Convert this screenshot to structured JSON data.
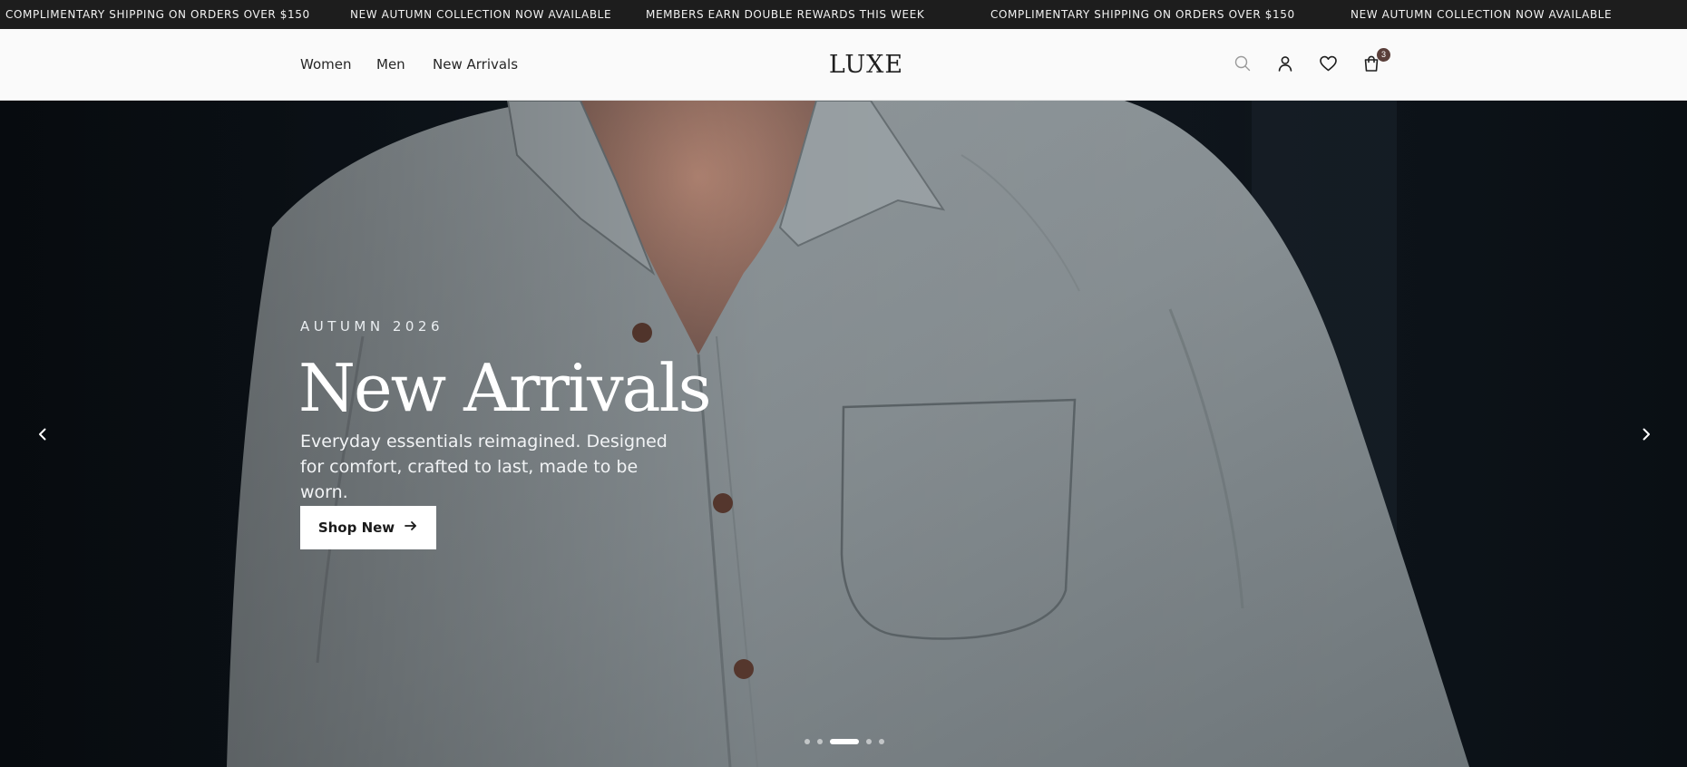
{
  "announcement": {
    "messages": [
      "COMPLIMENTARY SHIPPING ON ORDERS OVER $150",
      "NEW AUTUMN COLLECTION NOW AVAILABLE",
      "MEMBERS EARN DOUBLE REWARDS THIS WEEK",
      "COMPLIMENTARY SHIPPING ON ORDERS OVER $150",
      "NEW AUTUMN COLLECTION NOW AVAILABLE"
    ]
  },
  "header": {
    "nav": [
      "Women",
      "Men",
      "New Arrivals"
    ],
    "logo": "LUXE",
    "cart_count": "3",
    "icons": [
      "search-icon",
      "account-icon",
      "wishlist-icon",
      "cart-icon"
    ]
  },
  "hero": {
    "eyebrow": "AUTUMN 2026",
    "title": "New Arrivals",
    "subtitle": "Everyday essentials reimagined. Designed for comfort, crafted to last, made to be worn.",
    "cta": "Shop New",
    "slide_count": 5,
    "active_slide": 3
  },
  "colors": {
    "announcement_bg": "#1d1d1d",
    "header_bg": "#fafafa",
    "badge_bg": "#5a3f3a",
    "hero_bg": "#0b1016",
    "shirt": "#8b9397"
  }
}
